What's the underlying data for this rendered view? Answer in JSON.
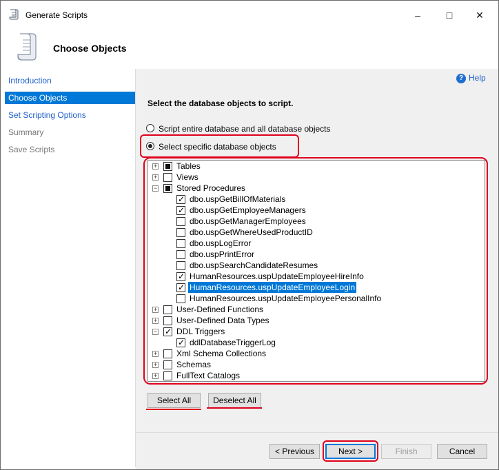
{
  "window": {
    "title": "Generate Scripts",
    "controls": {
      "minimize": "–",
      "maximize": "□",
      "close": "✕"
    }
  },
  "header": {
    "title": "Choose Objects",
    "icon": "scroll-icon"
  },
  "sidebar": {
    "items": [
      {
        "label": "Introduction",
        "state": "link"
      },
      {
        "label": "Choose Objects",
        "state": "selected"
      },
      {
        "label": "Set Scripting Options",
        "state": "link"
      },
      {
        "label": "Summary",
        "state": "disabled"
      },
      {
        "label": "Save Scripts",
        "state": "disabled"
      }
    ]
  },
  "help": {
    "label": "Help",
    "icon": "help-icon"
  },
  "main": {
    "instruction": "Select the database objects to script.",
    "radio_options": [
      {
        "label": "Script entire database and all database objects",
        "selected": false
      },
      {
        "label": "Select specific database objects",
        "selected": true
      }
    ]
  },
  "tree": {
    "nodes": [
      {
        "label": "Tables",
        "level": 0,
        "expander": "+",
        "check": "partial"
      },
      {
        "label": "Views",
        "level": 0,
        "expander": "+",
        "check": "none"
      },
      {
        "label": "Stored Procedures",
        "level": 0,
        "expander": "-",
        "check": "partial"
      },
      {
        "label": "dbo.uspGetBillOfMaterials",
        "level": 1,
        "check": "checked"
      },
      {
        "label": "dbo.uspGetEmployeeManagers",
        "level": 1,
        "check": "checked"
      },
      {
        "label": "dbo.uspGetManagerEmployees",
        "level": 1,
        "check": "none"
      },
      {
        "label": "dbo.uspGetWhereUsedProductID",
        "level": 1,
        "check": "none"
      },
      {
        "label": "dbo.uspLogError",
        "level": 1,
        "check": "none"
      },
      {
        "label": "dbo.uspPrintError",
        "level": 1,
        "check": "none"
      },
      {
        "label": "dbo.uspSearchCandidateResumes",
        "level": 1,
        "check": "none"
      },
      {
        "label": "HumanResources.uspUpdateEmployeeHireInfo",
        "level": 1,
        "check": "checked"
      },
      {
        "label": "HumanResources.uspUpdateEmployeeLogin",
        "level": 1,
        "check": "checked",
        "selected": true
      },
      {
        "label": "HumanResources.uspUpdateEmployeePersonalInfo",
        "level": 1,
        "check": "none"
      },
      {
        "label": "User-Defined Functions",
        "level": 0,
        "expander": "+",
        "check": "none"
      },
      {
        "label": "User-Defined Data Types",
        "level": 0,
        "expander": "+",
        "check": "none"
      },
      {
        "label": "DDL Triggers",
        "level": 0,
        "expander": "-",
        "check": "checked"
      },
      {
        "label": "ddlDatabaseTriggerLog",
        "level": 1,
        "check": "checked"
      },
      {
        "label": "Xml Schema Collections",
        "level": 0,
        "expander": "+",
        "check": "none"
      },
      {
        "label": "Schemas",
        "level": 0,
        "expander": "+",
        "check": "none"
      },
      {
        "label": "FullText Catalogs",
        "level": 0,
        "expander": "+",
        "check": "none"
      }
    ]
  },
  "selection_buttons": {
    "select_all": "Select All",
    "deselect_all": "Deselect All"
  },
  "footer": {
    "previous": "< Previous",
    "next": "Next >",
    "finish": "Finish",
    "cancel": "Cancel"
  },
  "colors": {
    "accent": "#0078d7",
    "link": "#1e5ec8",
    "annotation": "#e0001b",
    "panel": "#f0f0f0"
  }
}
